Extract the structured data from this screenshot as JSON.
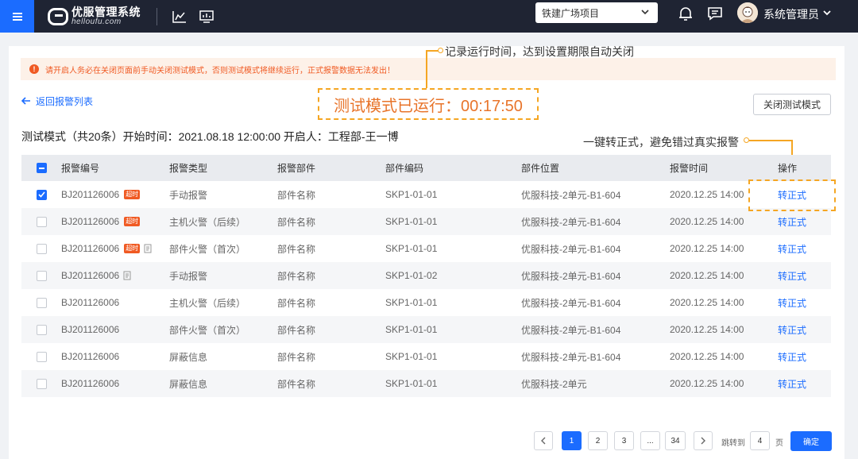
{
  "topbar": {
    "logo_cn": "优服管理系统",
    "logo_en": "helloufu.com",
    "project": "铁建广场项目",
    "user_name": "系统管理员",
    "icons": [
      "menu-icon",
      "chart-icon",
      "screen-icon",
      "bell-icon",
      "message-icon",
      "chevron-down-icon"
    ]
  },
  "alert": {
    "text": "请开启人务必在关闭页面前手动关闭测试模式，否则测试模式将继续运行，正式报警数据无法发出！"
  },
  "nav": {
    "back_label": "返回报警列表",
    "close_test_label": "关闭测试模式"
  },
  "timer": {
    "label": "测试模式已运行：00:17:50"
  },
  "callouts": {
    "timer_note": "记录运行时间，达到设置期限自动关闭",
    "convert_note": "一键转正式，避免错过真实报警"
  },
  "info": {
    "text": "测试模式（共20条）开始时间：2021.08.18 12:00:00  开启人：工程部-王一博"
  },
  "table": {
    "headers": [
      "报警编号",
      "报警类型",
      "报警部件",
      "部件编码",
      "部件位置",
      "报警时间",
      "操作"
    ],
    "overtime_tag": "超时",
    "rows": [
      {
        "checked": true,
        "id": "BJ201126006",
        "overtime": true,
        "doc": false,
        "type": "手动报警",
        "part": "部件名称",
        "code": "SKP1-01-01",
        "location": "优服科技-2单元-B1-604",
        "time": "2020.12.25 14:00",
        "action": "转正式"
      },
      {
        "checked": false,
        "id": "BJ201126006",
        "overtime": true,
        "doc": false,
        "type": "主机火警（后续）",
        "part": "部件名称",
        "code": "SKP1-01-01",
        "location": "优服科技-2单元-B1-604",
        "time": "2020.12.25 14:00",
        "action": "转正式"
      },
      {
        "checked": false,
        "id": "BJ201126006",
        "overtime": true,
        "doc": true,
        "type": "部件火警（首次）",
        "part": "部件名称",
        "code": "SKP1-01-01",
        "location": "优服科技-2单元-B1-604",
        "time": "2020.12.25 14:00",
        "action": "转正式"
      },
      {
        "checked": false,
        "id": "BJ201126006",
        "overtime": false,
        "doc": true,
        "type": "手动报警",
        "part": "部件名称",
        "code": "SKP1-01-02",
        "location": "优服科技-2单元-B1-604",
        "time": "2020.12.25 14:00",
        "action": "转正式"
      },
      {
        "checked": false,
        "id": "BJ201126006",
        "overtime": false,
        "doc": false,
        "type": "主机火警（后续）",
        "part": "部件名称",
        "code": "SKP1-01-01",
        "location": "优服科技-2单元-B1-604",
        "time": "2020.12.25 14:00",
        "action": "转正式"
      },
      {
        "checked": false,
        "id": "BJ201126006",
        "overtime": false,
        "doc": false,
        "type": "部件火警（首次）",
        "part": "部件名称",
        "code": "SKP1-01-01",
        "location": "优服科技-2单元-B1-604",
        "time": "2020.12.25 14:00",
        "action": "转正式"
      },
      {
        "checked": false,
        "id": "BJ201126006",
        "overtime": false,
        "doc": false,
        "type": "屏蔽信息",
        "part": "部件名称",
        "code": "SKP1-01-01",
        "location": "优服科技-2单元-B1-604",
        "time": "2020.12.25 14:00",
        "action": "转正式"
      },
      {
        "checked": false,
        "id": "BJ201126006",
        "overtime": false,
        "doc": false,
        "type": "屏蔽信息",
        "part": "部件名称",
        "code": "SKP1-01-01",
        "location": "优服科技-2单元",
        "time": "2020.12.25 14:00",
        "action": "转正式"
      }
    ]
  },
  "pagination": {
    "pages": [
      "1",
      "2",
      "3",
      "...",
      "34"
    ],
    "current": "1",
    "jump_label": "跳转到",
    "jump_value": "4",
    "page_unit": "页",
    "confirm_label": "确定"
  },
  "colors": {
    "primary": "#1b6cff",
    "topbar": "#1f2433",
    "warning": "#f05a23",
    "callout": "#f5a623"
  }
}
